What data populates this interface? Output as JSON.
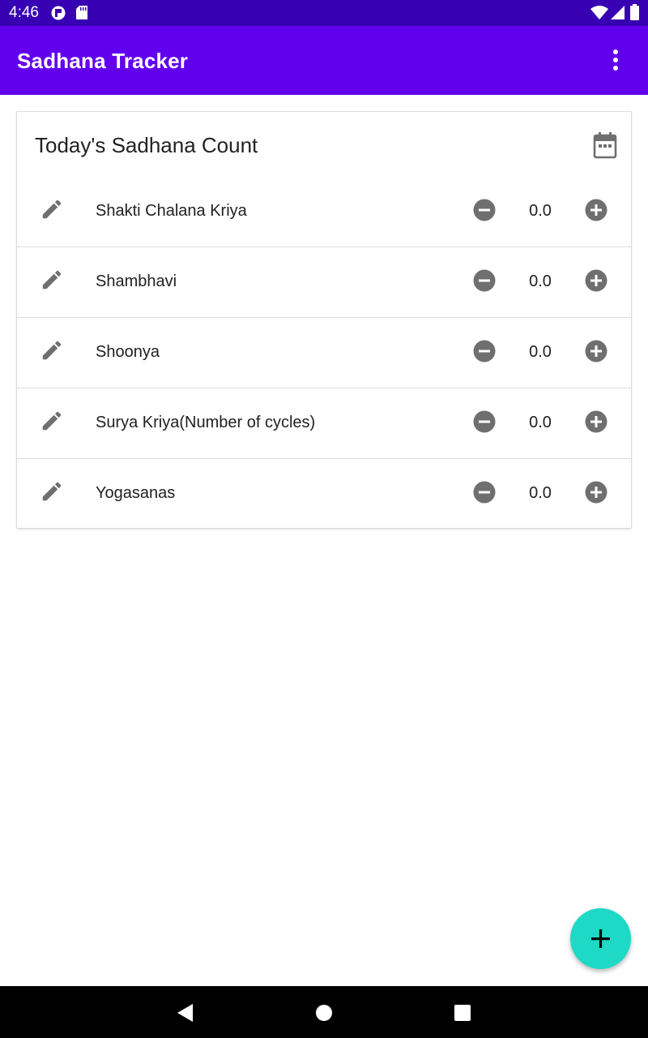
{
  "status_bar": {
    "time": "4:46"
  },
  "app_bar": {
    "title": "Sadhana Tracker"
  },
  "card": {
    "title": "Today's Sadhana Count",
    "items": [
      {
        "label": "Shakti Chalana Kriya",
        "value": "0.0"
      },
      {
        "label": "Shambhavi",
        "value": "0.0"
      },
      {
        "label": "Shoonya",
        "value": "0.0"
      },
      {
        "label": "Surya Kriya(Number of cycles)",
        "value": "0.0"
      },
      {
        "label": "Yogasanas",
        "value": "0.0"
      }
    ]
  },
  "icons": {
    "overflow": "more-vert-icon",
    "calendar": "calendar-icon",
    "edit": "pencil-icon",
    "decrement": "minus-circle-icon",
    "increment": "plus-circle-icon",
    "fab": "plus-icon"
  },
  "colors": {
    "status_bar": "#3700b3",
    "app_bar": "#6200ee",
    "fab": "#1dd9c6",
    "icon_gray": "#6f6f6f"
  }
}
